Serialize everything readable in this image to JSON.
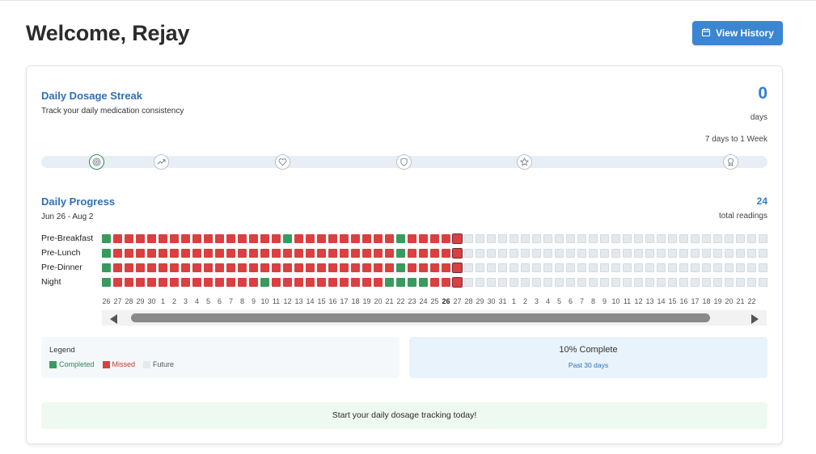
{
  "header": {
    "welcome": "Welcome, Rejay",
    "history_button": "View History",
    "history_icon": "calendar-icon"
  },
  "streak": {
    "title": "Daily Dosage Streak",
    "subtitle": "Track your daily medication consistency",
    "count": "0",
    "unit": "days",
    "goal": "7 days to 1 Week",
    "milestones": [
      {
        "icon": "target-icon",
        "active": true
      },
      {
        "icon": "trending-up-icon",
        "active": false
      },
      {
        "icon": "heart-icon",
        "active": false
      },
      {
        "icon": "shield-icon",
        "active": false
      },
      {
        "icon": "star-icon",
        "active": false
      },
      {
        "icon": "award-icon",
        "active": false
      }
    ]
  },
  "progress": {
    "title": "Daily Progress",
    "range": "Jun 26 - Aug 2",
    "readings_count": "24",
    "readings_label": "total readings",
    "rows": [
      {
        "label": "Pre-Breakfast",
        "cells": "CMMMMMMMMMMMMMMMCMMMMMMMMMCMMMMT"
      },
      {
        "label": "Pre-Lunch",
        "cells": "CMMMMMMMMMMMMMMMMMMMMMMMMMCMMMMT"
      },
      {
        "label": "Pre-Dinner",
        "cells": "CMMMMMMMMMMMMMMMMMMMMMMMMMCMMMMT"
      },
      {
        "label": "Night",
        "cells": "CMMMMMMMMMMMMMCMMMMMMMMMMCCCCMMT"
      }
    ],
    "future_count": 27,
    "days": [
      "26",
      "27",
      "28",
      "29",
      "30",
      "1",
      "2",
      "3",
      "4",
      "5",
      "6",
      "7",
      "8",
      "9",
      "10",
      "11",
      "12",
      "13",
      "14",
      "15",
      "16",
      "17",
      "18",
      "19",
      "20",
      "21",
      "22",
      "23",
      "24",
      "25",
      "26",
      "27",
      "28",
      "29",
      "30",
      "31",
      "1",
      "2",
      "3",
      "4",
      "5",
      "6",
      "7",
      "8",
      "9",
      "10",
      "11",
      "12",
      "13",
      "14",
      "15",
      "16",
      "17",
      "18",
      "19",
      "20",
      "21",
      "22"
    ],
    "today_index": 30
  },
  "legend": {
    "title": "Legend",
    "completed": "Completed",
    "missed": "Missed",
    "future": "Future"
  },
  "completion": {
    "percent": "10% Complete",
    "period": "Past 30 days"
  },
  "banner": {
    "text": "Start your daily dosage tracking today!"
  },
  "colors": {
    "accent": "#3a86d2",
    "completed": "#3a9a5e",
    "missed": "#d9403f",
    "future": "#e4e9ee"
  }
}
